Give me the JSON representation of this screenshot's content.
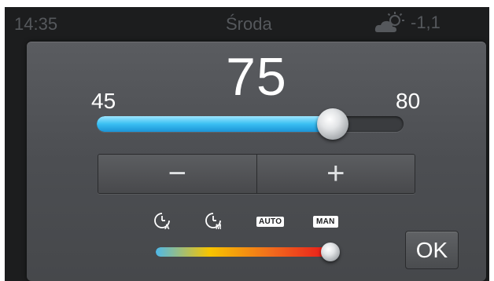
{
  "status_bar": {
    "time": "14:35",
    "day": "Środa",
    "temperature": "-1,1",
    "weather_icon": "partly-cloudy-icon"
  },
  "dialog": {
    "value": "75",
    "min": "45",
    "max": "80",
    "slider_value": 75,
    "slider_min": 45,
    "slider_max": 80,
    "decrement_symbol": "−",
    "increment_symbol": "+",
    "modes": [
      {
        "name": "auto-clock-a",
        "icon": "clock-a-icon",
        "label": ""
      },
      {
        "name": "clock-m",
        "icon": "clock-m-icon",
        "label": ""
      },
      {
        "name": "auto",
        "icon": "",
        "label": "AUTO"
      },
      {
        "name": "man",
        "icon": "",
        "label": "MAN"
      }
    ],
    "selected_mode": "MAN",
    "mode_position_fraction": 1.0,
    "ok_label": "OK"
  },
  "colors": {
    "accent_blue": "#39bff2",
    "mode_gradient_start": "#4fb8e8",
    "mode_gradient_end": "#e8101a"
  }
}
